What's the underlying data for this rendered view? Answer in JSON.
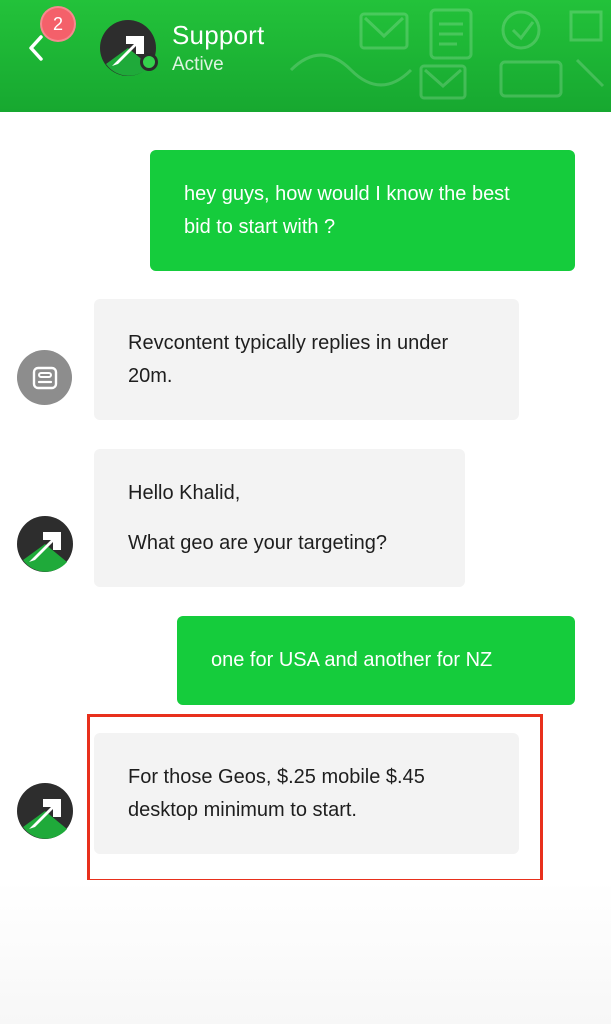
{
  "header": {
    "back_icon": "chevron-left-icon",
    "badge_count": "2",
    "title": "Support",
    "status": "Active",
    "accent_color": "#1fba36",
    "badge_color": "#f4606a"
  },
  "messages": [
    {
      "direction": "outgoing",
      "text": "hey guys, how would I know the best bid to start with ?"
    },
    {
      "direction": "incoming",
      "sender_icon": "bot-icon",
      "text": "Revcontent typically replies in under 20m."
    },
    {
      "direction": "incoming",
      "sender_icon": "agent-avatar",
      "paragraphs": [
        "Hello Khalid,",
        "What geo are your targeting?"
      ]
    },
    {
      "direction": "outgoing",
      "text": "one for USA and another for NZ"
    },
    {
      "direction": "incoming",
      "sender_icon": "agent-avatar",
      "text": "For those Geos, $.25 mobile $.45 desktop minimum to start.",
      "highlighted": true
    }
  ],
  "colors": {
    "outgoing_bubble": "#15cc3c",
    "incoming_bubble": "#f3f3f3",
    "highlight_border": "#e8301c"
  }
}
